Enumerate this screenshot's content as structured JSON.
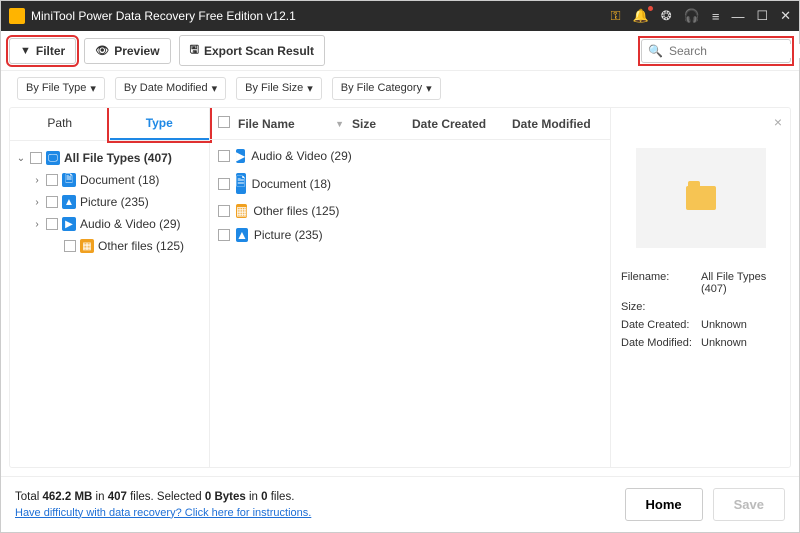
{
  "titlebar": {
    "title": "MiniTool Power Data Recovery Free Edition v12.1"
  },
  "toolbar": {
    "filter_label": "Filter",
    "preview_label": "Preview",
    "export_label": "Export Scan Result",
    "search_placeholder": "Search"
  },
  "filters": {
    "file_type": "By File Type",
    "date_modified": "By Date Modified",
    "file_size": "By File Size",
    "file_category": "By File Category"
  },
  "tabs": {
    "path": "Path",
    "type": "Type"
  },
  "tree": {
    "root": "All File Types (407)",
    "items": [
      {
        "label": "Document (18)",
        "icon": "doc",
        "expandable": true
      },
      {
        "label": "Picture (235)",
        "icon": "pic",
        "expandable": true
      },
      {
        "label": "Audio & Video (29)",
        "icon": "av",
        "expandable": true
      },
      {
        "label": "Other files (125)",
        "icon": "other",
        "expandable": false
      }
    ]
  },
  "columns": {
    "name": "File Name",
    "size": "Size",
    "created": "Date Created",
    "modified": "Date Modified"
  },
  "files": [
    {
      "label": "Audio & Video (29)",
      "icon": "av"
    },
    {
      "label": "Document (18)",
      "icon": "doc"
    },
    {
      "label": "Other files (125)",
      "icon": "other"
    },
    {
      "label": "Picture (235)",
      "icon": "pic"
    }
  ],
  "details": {
    "filename_k": "Filename:",
    "filename_v": "All File Types (407)",
    "size_k": "Size:",
    "size_v": "",
    "created_k": "Date Created:",
    "created_v": "Unknown",
    "modified_k": "Date Modified:",
    "modified_v": "Unknown"
  },
  "footer": {
    "line1_a": "Total ",
    "total_size": "462.2 MB",
    "line1_b": " in ",
    "total_files": "407",
    "line1_c": " files.   Selected ",
    "sel_size": "0 Bytes",
    "line1_d": " in ",
    "sel_files": "0",
    "line1_e": " files.",
    "help": "Have difficulty with data recovery? Click here for instructions.",
    "home": "Home",
    "save": "Save"
  }
}
